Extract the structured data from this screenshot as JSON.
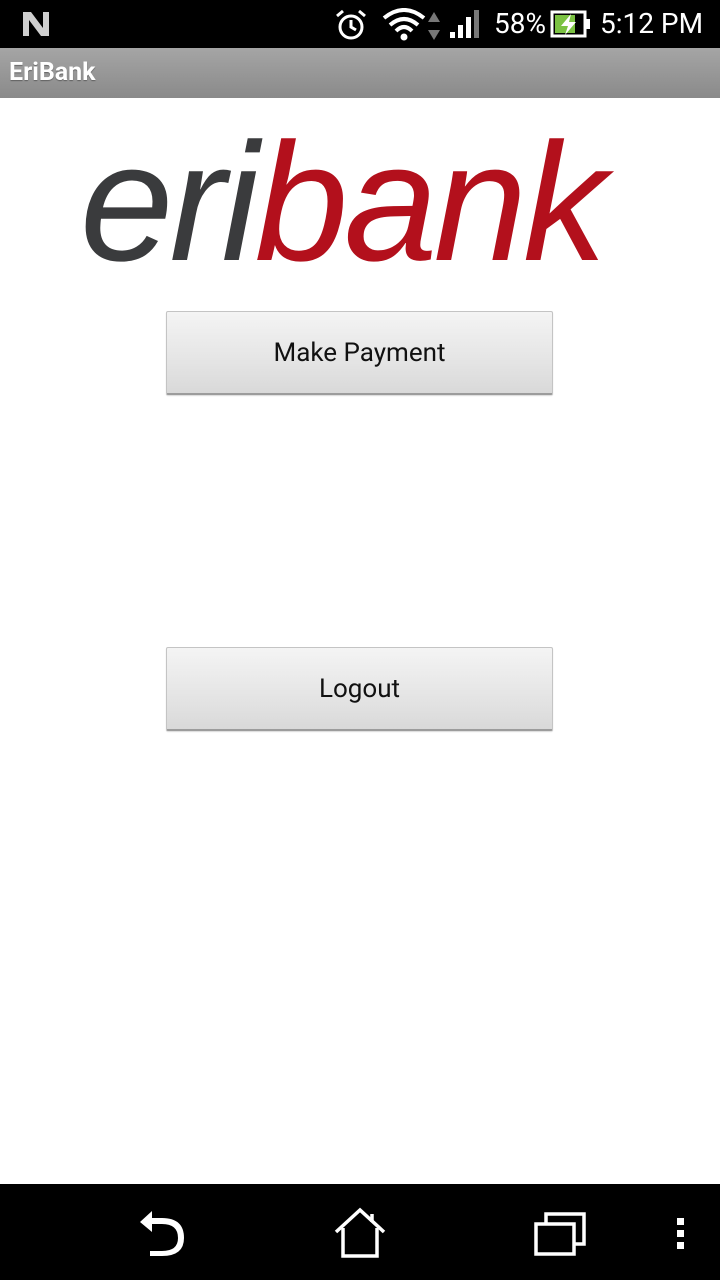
{
  "status_bar": {
    "icons": [
      "nfc-icon",
      "alarm-icon",
      "wifi-icon",
      "signal-icon",
      "battery-charging-icon"
    ],
    "battery_percent": "58%",
    "time": "5:12 PM",
    "battery_color": "#7bc242"
  },
  "action_bar": {
    "title": "EriBank"
  },
  "logo": {
    "part1": "eri",
    "part2": "bank",
    "part1_color": "#3a3b3d",
    "part2_color": "#b3101c"
  },
  "main": {
    "make_payment_label": "Make Payment",
    "logout_label": "Logout"
  },
  "nav_bar": {
    "icons": [
      "back-icon",
      "home-icon",
      "recent-apps-icon",
      "overflow-menu-icon"
    ]
  }
}
